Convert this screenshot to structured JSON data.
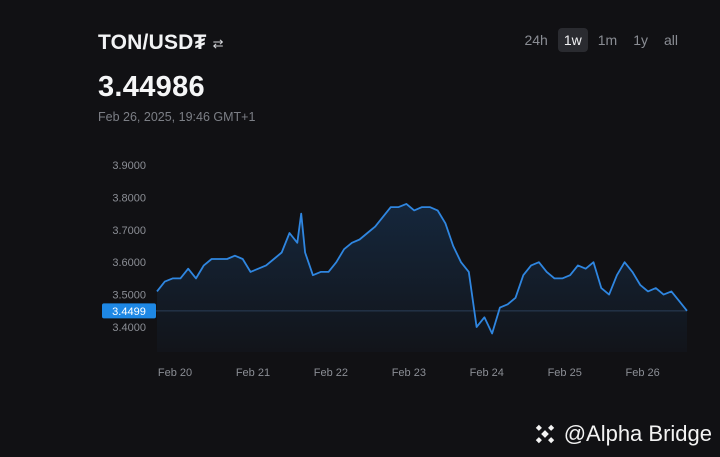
{
  "header": {
    "pair": "TON/USD₮",
    "swap_icon": "swap-arrows-icon",
    "price": "3.44986",
    "timestamp": "Feb 26, 2025, 19:46 GMT+1"
  },
  "ranges": [
    {
      "label": "24h",
      "active": false
    },
    {
      "label": "1w",
      "active": true
    },
    {
      "label": "1m",
      "active": false
    },
    {
      "label": "1y",
      "active": false
    },
    {
      "label": "all",
      "active": false
    }
  ],
  "watermark": {
    "icon": "binance-logo-icon",
    "text": "@Alpha Bridge"
  },
  "colors": {
    "line": "#2f86e0",
    "badge": "#1e88e5",
    "axis_text": "#8b8e95"
  },
  "chart_data": {
    "type": "line",
    "x_ticks": [
      "Feb 20",
      "Feb 21",
      "Feb 22",
      "Feb 23",
      "Feb 24",
      "Feb 25",
      "Feb 26"
    ],
    "y_ticks": [
      "3.9000",
      "3.8000",
      "3.7000",
      "3.6000",
      "3.5000",
      "3.4000"
    ],
    "ylim": [
      3.37,
      3.93
    ],
    "current_label": "3.4499",
    "current_value": 3.4499,
    "series": [
      {
        "x": [
          0,
          0.1,
          0.2,
          0.3,
          0.4,
          0.5,
          0.6,
          0.7,
          0.8,
          0.9,
          1.0,
          1.1,
          1.2,
          1.3,
          1.4,
          1.5,
          1.6,
          1.7,
          1.8,
          1.85,
          1.9,
          2.0,
          2.1,
          2.2,
          2.3,
          2.4,
          2.5,
          2.6,
          2.7,
          2.8,
          2.9,
          3.0,
          3.1,
          3.2,
          3.3,
          3.4,
          3.5,
          3.6,
          3.7,
          3.8,
          3.9,
          4.0,
          4.1,
          4.2,
          4.3,
          4.4,
          4.5,
          4.6,
          4.7,
          4.8,
          4.9,
          5.0,
          5.1,
          5.2,
          5.3,
          5.4,
          5.5,
          5.6,
          5.7,
          5.8,
          5.9,
          6.0,
          6.1,
          6.2,
          6.3,
          6.4,
          6.5,
          6.6,
          6.7,
          6.8
        ],
        "y": [
          3.51,
          3.54,
          3.55,
          3.55,
          3.58,
          3.55,
          3.59,
          3.61,
          3.61,
          3.61,
          3.62,
          3.61,
          3.57,
          3.58,
          3.59,
          3.61,
          3.63,
          3.69,
          3.66,
          3.75,
          3.63,
          3.56,
          3.57,
          3.57,
          3.6,
          3.64,
          3.66,
          3.67,
          3.69,
          3.71,
          3.74,
          3.77,
          3.77,
          3.78,
          3.76,
          3.77,
          3.77,
          3.76,
          3.72,
          3.65,
          3.6,
          3.57,
          3.4,
          3.43,
          3.38,
          3.46,
          3.47,
          3.49,
          3.56,
          3.59,
          3.6,
          3.57,
          3.55,
          3.55,
          3.56,
          3.59,
          3.58,
          3.6,
          3.52,
          3.5,
          3.56,
          3.6,
          3.57,
          3.53,
          3.51,
          3.52,
          3.5,
          3.51,
          3.48,
          3.4499
        ]
      }
    ]
  }
}
